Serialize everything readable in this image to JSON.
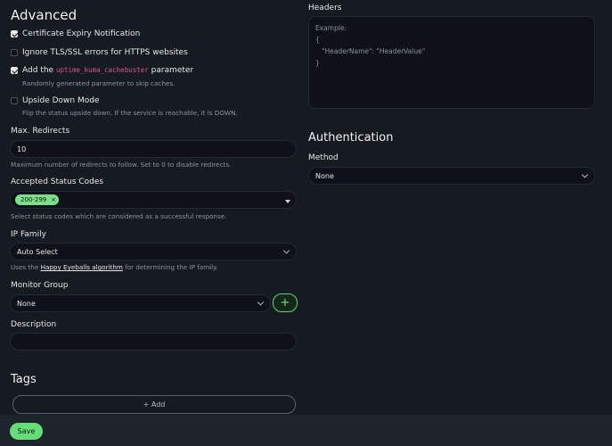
{
  "advanced": {
    "title": "Advanced",
    "cert_expiry": {
      "label": "Certificate Expiry Notification",
      "checked": true
    },
    "ignore_tls": {
      "label": "Ignore TLS/SSL errors for HTTPS websites",
      "checked": false
    },
    "cachebuster": {
      "label_before": "Add the",
      "code": "uptime_kuma_cachebuster",
      "label_after": "parameter",
      "help": "Randomly generated parameter to skip caches.",
      "checked": true
    },
    "upside_down": {
      "label": "Upside Down Mode",
      "help": "Flip the status upside down. If the service is reachable, it is DOWN.",
      "checked": false
    },
    "max_redirects": {
      "label": "Max. Redirects",
      "value": "10",
      "help": "Maximum number of redirects to follow. Set to 0 to disable redirects."
    },
    "accepted_codes": {
      "label": "Accepted Status Codes",
      "tags": [
        "200-299"
      ],
      "tag_remove": "×",
      "help": "Select status codes which are considered as a successful response."
    },
    "ip_family": {
      "label": "IP Family",
      "value": "Auto Select",
      "help_before": "Uses the",
      "help_link": "Happy Eyeballs algorithm",
      "help_after": "for determining the IP family."
    },
    "monitor_group": {
      "label": "Monitor Group",
      "value": "None",
      "add": "+"
    },
    "description": {
      "label": "Description",
      "value": ""
    }
  },
  "tags": {
    "title": "Tags",
    "add_label": "+ Add"
  },
  "headers": {
    "label": "Headers",
    "placeholder": "Example:\n{\n   \"HeaderName\": \"HeaderValue\"\n}"
  },
  "authentication": {
    "title": "Authentication",
    "method_label": "Method",
    "method_value": "None"
  },
  "footer": {
    "save_label": "Save"
  },
  "colors": {
    "background": "#161b22",
    "accent": "#66dd78",
    "code": "#e3508a"
  }
}
